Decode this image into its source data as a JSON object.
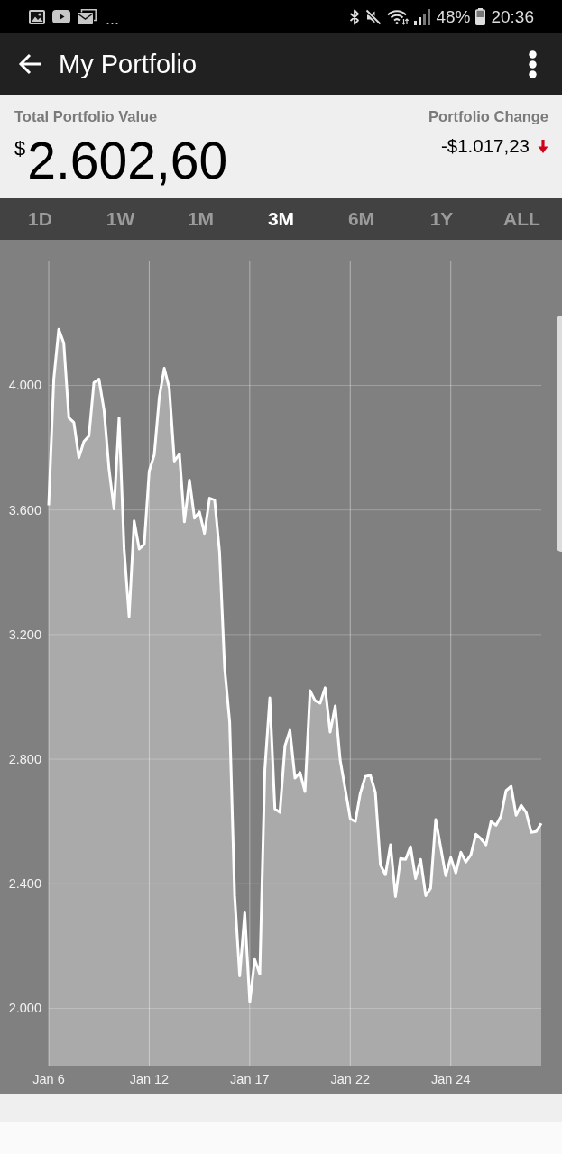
{
  "status_bar": {
    "notifications_more": "...",
    "battery": "48%",
    "time": "20:36"
  },
  "app_bar": {
    "title": "My Portfolio"
  },
  "summary": {
    "value_label": "Total Portfolio Value",
    "currency": "$",
    "amount": "2.602,60",
    "change_label": "Portfolio Change",
    "change": "-$1.017,23",
    "change_negative": true
  },
  "tabs": [
    {
      "label": "1D",
      "selected": false
    },
    {
      "label": "1W",
      "selected": false
    },
    {
      "label": "1M",
      "selected": false
    },
    {
      "label": "3M",
      "selected": true
    },
    {
      "label": "6M",
      "selected": false
    },
    {
      "label": "1Y",
      "selected": false
    },
    {
      "label": "ALL",
      "selected": false
    }
  ],
  "chart": {
    "chart_data": {
      "type": "area",
      "grid": true,
      "categories": [
        "Jan 6",
        null,
        null,
        null,
        null,
        null,
        null,
        null,
        null,
        null,
        null,
        null,
        null,
        null,
        null,
        null,
        null,
        null,
        null,
        null,
        "Jan 12",
        null,
        null,
        null,
        null,
        null,
        null,
        null,
        null,
        null,
        null,
        null,
        null,
        null,
        null,
        null,
        null,
        null,
        null,
        null,
        "Jan 17",
        null,
        null,
        null,
        null,
        null,
        null,
        null,
        null,
        null,
        null,
        null,
        null,
        null,
        null,
        null,
        null,
        null,
        null,
        null,
        "Jan 22",
        null,
        null,
        null,
        null,
        null,
        null,
        null,
        null,
        null,
        null,
        null,
        null,
        null,
        null,
        null,
        null,
        null,
        null,
        null,
        "Jan 24",
        null,
        null,
        null,
        null,
        null,
        null,
        null,
        null,
        null,
        null,
        null,
        null,
        null,
        null,
        null,
        null,
        null,
        null
      ],
      "series": [
        {
          "color": "#ffffff",
          "values": [
            3615,
            4020,
            4180,
            4136,
            3896,
            3881,
            3768,
            3820,
            3838,
            4009,
            4020,
            3922,
            3730,
            3603,
            3896,
            3475,
            3258,
            3565,
            3475,
            3490,
            3725,
            3777,
            3962,
            4055,
            3991,
            3757,
            3780,
            3562,
            3696,
            3574,
            3594,
            3525,
            3638,
            3632,
            3464,
            3093,
            2919,
            2362,
            2104,
            2307,
            2020,
            2157,
            2110,
            2768,
            2997,
            2641,
            2629,
            2843,
            2893,
            2739,
            2757,
            2696,
            3020,
            2988,
            2980,
            3029,
            2887,
            2971,
            2797,
            2704,
            2609,
            2600,
            2690,
            2745,
            2748,
            2693,
            2461,
            2429,
            2525,
            2359,
            2481,
            2478,
            2519,
            2417,
            2478,
            2362,
            2386,
            2606,
            2516,
            2426,
            2484,
            2435,
            2501,
            2470,
            2493,
            2559,
            2545,
            2525,
            2600,
            2588,
            2617,
            2699,
            2713,
            2620,
            2652,
            2629,
            2565,
            2568,
            2594
          ]
        }
      ],
      "ylim": [
        1816,
        4398
      ],
      "yticks": [
        {
          "value": 2000,
          "label": "2.000"
        },
        {
          "value": 2400,
          "label": "2.400"
        },
        {
          "value": 2800,
          "label": "2.800"
        },
        {
          "value": 3200,
          "label": "3.200"
        },
        {
          "value": 3600,
          "label": "3.600"
        },
        {
          "value": 4000,
          "label": "4.000"
        }
      ]
    }
  }
}
